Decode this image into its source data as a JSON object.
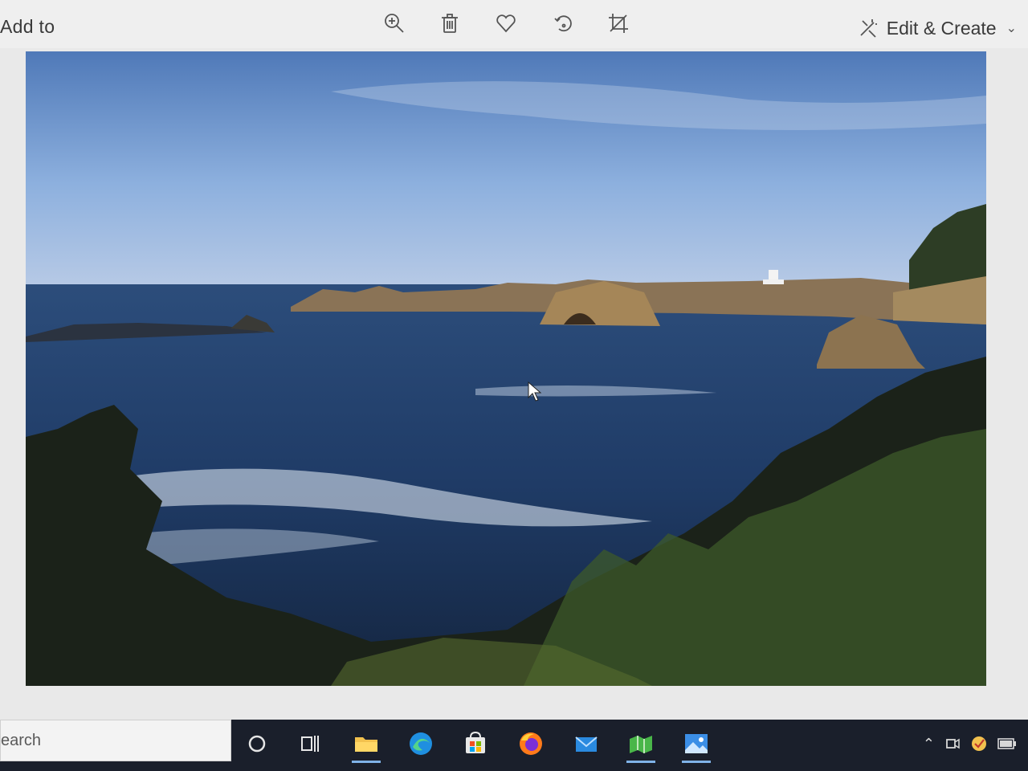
{
  "toolbar": {
    "add_to_label": "Add to",
    "icons": [
      "zoom-in-icon",
      "trash-icon",
      "heart-icon",
      "rotate-icon",
      "crop-icon"
    ],
    "edit_create_label": "Edit & Create",
    "edit_create_chevron": "⌄"
  },
  "taskbar": {
    "search_placeholder": "earch",
    "apps": [
      "cortana",
      "task-view",
      "file-explorer",
      "edge",
      "store",
      "firefox",
      "mail",
      "maps",
      "photos"
    ]
  },
  "colors": {
    "taskbar": "#1a1f2b",
    "toolbar": "#efefef",
    "accent": "#7fb2e8"
  }
}
